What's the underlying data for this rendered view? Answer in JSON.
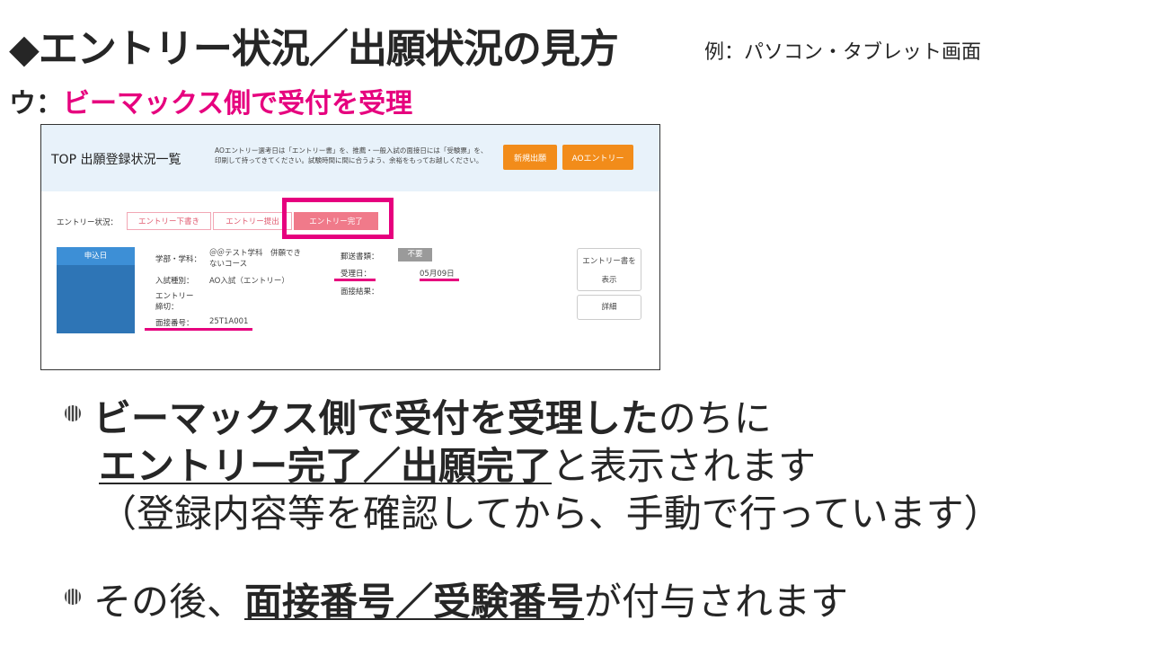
{
  "slide": {
    "title": "◆エントリー状況／出願状況の見方",
    "title_note": "例：パソコン・タブレット画面",
    "subtitle_prefix": "ウ：",
    "subtitle_highlight": "ビーマックス側で受付を受理"
  },
  "screenshot": {
    "heading": "TOP 出願登録状況一覧",
    "notice": "AOエントリー選考日は「エントリー書」を、推薦・一般入試の面接日には「受験票」を、印刷して持ってきてください。試験時間に間に合うよう、余裕をもってお越しください。",
    "buttons": {
      "new_application": "新規出願",
      "ao_entry": "AOエントリー"
    },
    "status_label": "エントリー状況：",
    "steps": [
      "エントリー下書き",
      "エントリー提出",
      "エントリー完了"
    ],
    "date_box_header": "申込日",
    "fields": {
      "faculty_label": "学部・学科：",
      "faculty_value_1": "＠＠テスト学科　併願でき",
      "faculty_value_2": "ないコース",
      "exam_type_label": "入試種別：",
      "exam_type_value": "AO入試（エントリー）",
      "deadline_label_1": "エントリー",
      "deadline_label_2": "締切：",
      "interview_no_label": "面接番号：",
      "interview_no_value": "25T1A001",
      "mail_docs_label": "郵送書類：",
      "mail_docs_value": "不要",
      "received_date_label": "受理日：",
      "received_date_value": "05月09日",
      "interview_result_label": "面接結果："
    },
    "side_buttons": {
      "show_entry_1": "エントリー書を",
      "show_entry_2": "表示",
      "detail": "詳細"
    }
  },
  "bullets": {
    "b1_bold": "ビーマックス側で受付を受理した",
    "b1_rest": "のちに",
    "b1_line2_underlined": "エントリー完了／出願完了",
    "b1_line2_rest": "と表示されます",
    "b1_line3": "（登録内容等を確認してから、手動で行っています）",
    "b2_pre": "その後、",
    "b2_underlined": "面接番号／受験番号",
    "b2_rest": "が付与されます"
  },
  "colors": {
    "accent_magenta": "#e6007e",
    "orange": "#f28c1a",
    "blue": "#2e75b6",
    "header_bg": "#e8f2fa"
  }
}
